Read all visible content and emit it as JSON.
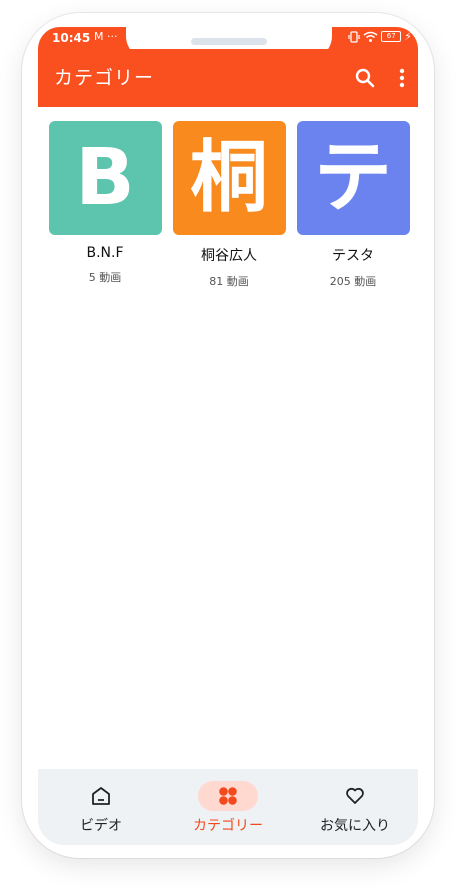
{
  "status_bar": {
    "time": "10:45",
    "left_icons": "M ···",
    "battery_level": "67"
  },
  "app_bar": {
    "title": "カテゴリー",
    "color": "#fa4f1f"
  },
  "categories": [
    {
      "letter": "B",
      "name": "B.N.F",
      "count": "5 動画",
      "color": "#5dc4ae"
    },
    {
      "letter": "桐",
      "name": "桐谷広人",
      "count": "81 動画",
      "color": "#f98a1e"
    },
    {
      "letter": "テ",
      "name": "テスタ",
      "count": "205 動画",
      "color": "#6b83ef"
    }
  ],
  "bottom_nav": {
    "items": [
      {
        "label": "ビデオ",
        "icon": "home-icon",
        "active": false
      },
      {
        "label": "カテゴリー",
        "icon": "grid-icon",
        "active": true
      },
      {
        "label": "お気に入り",
        "icon": "heart-icon",
        "active": false
      }
    ],
    "accent": "#f24a1c"
  }
}
